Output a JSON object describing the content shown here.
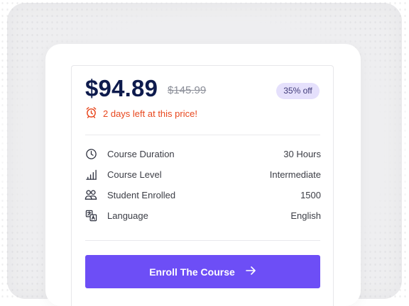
{
  "pricing": {
    "current_price": "$94.89",
    "original_price": "$145.99",
    "discount_badge": "35% off",
    "urgency_text": "2 days left at this price!",
    "accent_color": "#6d4ef6",
    "urgency_color": "#e8471e"
  },
  "details": [
    {
      "icon": "clock-icon",
      "label": "Course Duration",
      "value": "30 Hours"
    },
    {
      "icon": "level-bars-icon",
      "label": "Course Level",
      "value": "Intermediate"
    },
    {
      "icon": "students-icon",
      "label": "Student Enrolled",
      "value": "1500"
    },
    {
      "icon": "language-icon",
      "label": "Language",
      "value": "English"
    }
  ],
  "cta": {
    "label": "Enroll The Course",
    "icon": "arrow-right-icon"
  }
}
